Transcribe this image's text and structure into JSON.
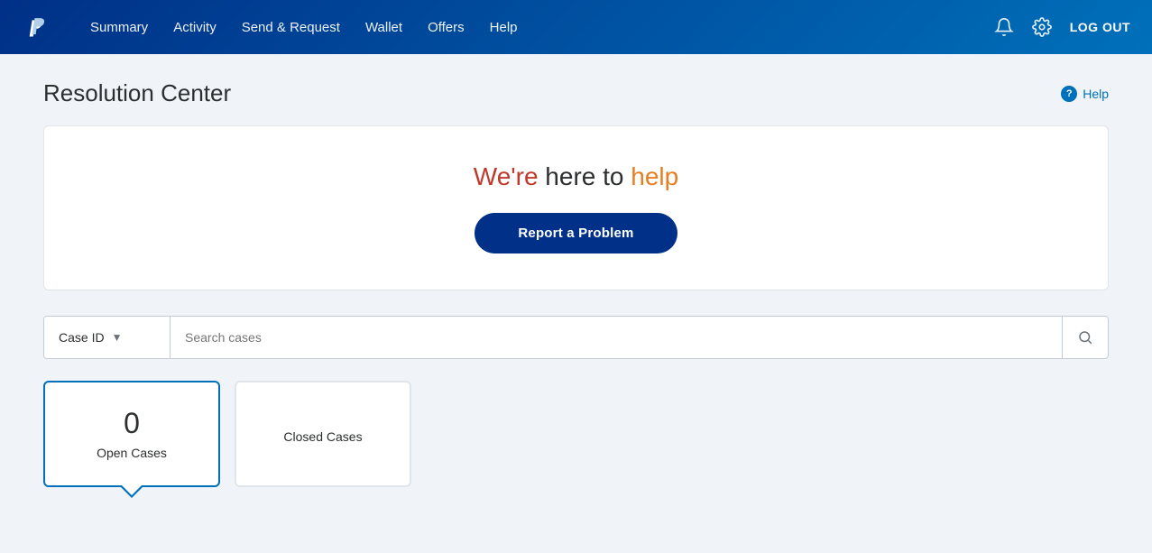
{
  "navbar": {
    "links": [
      {
        "id": "summary",
        "label": "Summary"
      },
      {
        "id": "activity",
        "label": "Activity"
      },
      {
        "id": "send-request",
        "label": "Send & Request"
      },
      {
        "id": "wallet",
        "label": "Wallet"
      },
      {
        "id": "offers",
        "label": "Offers"
      },
      {
        "id": "help",
        "label": "Help"
      }
    ],
    "logout_label": "LOG OUT"
  },
  "page": {
    "title": "Resolution Center",
    "help_label": "Help"
  },
  "hero": {
    "title_we": "We're",
    "title_here": " here to ",
    "title_help": "help",
    "report_button": "Report a Problem"
  },
  "search": {
    "dropdown_label": "Case ID",
    "placeholder": "Search cases"
  },
  "cases": {
    "open": {
      "count": "0",
      "label": "Open Cases"
    },
    "closed": {
      "label": "Closed Cases"
    }
  }
}
